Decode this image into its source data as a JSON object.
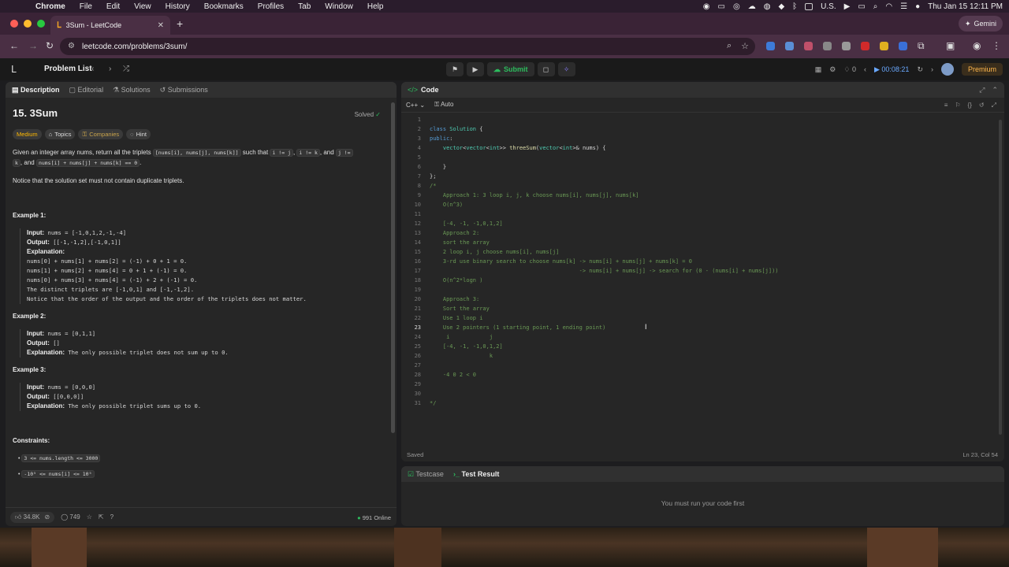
{
  "menubar": {
    "app": "Chrome",
    "items": [
      "File",
      "Edit",
      "View",
      "History",
      "Bookmarks",
      "Profiles",
      "Tab",
      "Window",
      "Help"
    ],
    "input_source": "U.S.",
    "datetime": "Thu Jan 15  12:11 PM"
  },
  "browser": {
    "tab_title": "3Sum - LeetCode",
    "url": "leetcode.com/problems/3sum/",
    "gemini_label": "Gemini"
  },
  "lc_header": {
    "problem_list": "Problem List",
    "submit": "Submit",
    "streak": "0",
    "timer": "00:08:21",
    "premium": "Premium"
  },
  "description": {
    "tabs": [
      "Description",
      "Editorial",
      "Solutions",
      "Submissions"
    ],
    "title": "15. 3Sum",
    "solved": "Solved",
    "tags": [
      "Medium",
      "Topics",
      "Companies",
      "Hint"
    ],
    "p1_a": "Given an integer array nums, return all the triplets ",
    "p1_code1": "[nums[i], nums[j], nums[k]]",
    "p1_b": " such that ",
    "p1_code2": "i != j",
    "p1_c": ", ",
    "p1_code3": "i != k",
    "p1_d": ", and ",
    "p1_code4": "j !=",
    "p1_code4b": "k",
    "p1_e": ", and ",
    "p1_code5": "nums[i] + nums[j] + nums[k] == 0",
    "p1_f": ".",
    "p2": "Notice that the solution set must not contain duplicate triplets.",
    "ex1_title": "Example 1:",
    "ex1_input_label": "Input:",
    "ex1_input": " nums = [-1,0,1,2,-1,-4]",
    "ex1_output_label": "Output:",
    "ex1_output": " [[-1,-1,2],[-1,0,1]]",
    "ex1_expl_label": "Explanation:",
    "ex1_lines": [
      "nums[0] + nums[1] + nums[2] = (-1) + 0 + 1 = 0.",
      "nums[1] + nums[2] + nums[4] = 0 + 1 + (-1) = 0.",
      "nums[0] + nums[3] + nums[4] = (-1) + 2 + (-1) = 0.",
      "The distinct triplets are [-1,0,1] and [-1,-1,2].",
      "Notice that the order of the output and the order of the triplets does not matter."
    ],
    "ex2_title": "Example 2:",
    "ex2_input_label": "Input:",
    "ex2_input": " nums = [0,1,1]",
    "ex2_output_label": "Output:",
    "ex2_output": " []",
    "ex2_expl_label": "Explanation:",
    "ex2_expl": " The only possible triplet does not sum up to 0.",
    "ex3_title": "Example 3:",
    "ex3_input_label": "Input:",
    "ex3_input": " nums = [0,0,0]",
    "ex3_output_label": "Output:",
    "ex3_output": " [[0,0,0]]",
    "ex3_expl_label": "Explanation:",
    "ex3_expl": " The only possible triplet sums up to 0.",
    "constraints_title": "Constraints:",
    "constraint1": "3 <= nums.length <= 3000",
    "constraint2": "-10⁵ <= nums[i] <= 10⁵",
    "likes": "34.8K",
    "comments": "749",
    "online": "991 Online"
  },
  "code": {
    "title": "Code",
    "language": "C++",
    "mode": "Auto",
    "saved": "Saved",
    "cursor_pos": "Ln 23, Col 54",
    "lines": [
      "",
      "class Solution {",
      "public:",
      "    vector<vector<int>> threeSum(vector<int>& nums) {",
      "",
      "    }",
      "};",
      "/*",
      "    Approach 1: 3 loop i, j, k choose nums[i], nums[j], nums[k]",
      "    O(n^3)",
      "",
      "    [-4, -1, -1,0,1,2]",
      "    Approach 2:",
      "    sort the array",
      "    2 loop i, j choose nums[i], nums[j]",
      "    3-rd use binary search to choose nums[k] -> nums[i] + nums[j] + nums[k] = 0",
      "                                             -> nums[i] + nums[j] -> search for (0 - (nums[i] + nums[j]))",
      "    O(n^2*logn )",
      "",
      "    Approach 3:",
      "    Sort the array",
      "    Use 1 loop i",
      "    Use 2 pointers (1 starting point, 1 ending point)",
      "     i            j",
      "    [-4, -1, -1,0,1,2]",
      "                  k",
      "",
      "    -4 0 2 < 0",
      "",
      "",
      "*/"
    ]
  },
  "result": {
    "tabs": [
      "Testcase",
      "Test Result"
    ],
    "message": "You must run your code first"
  }
}
